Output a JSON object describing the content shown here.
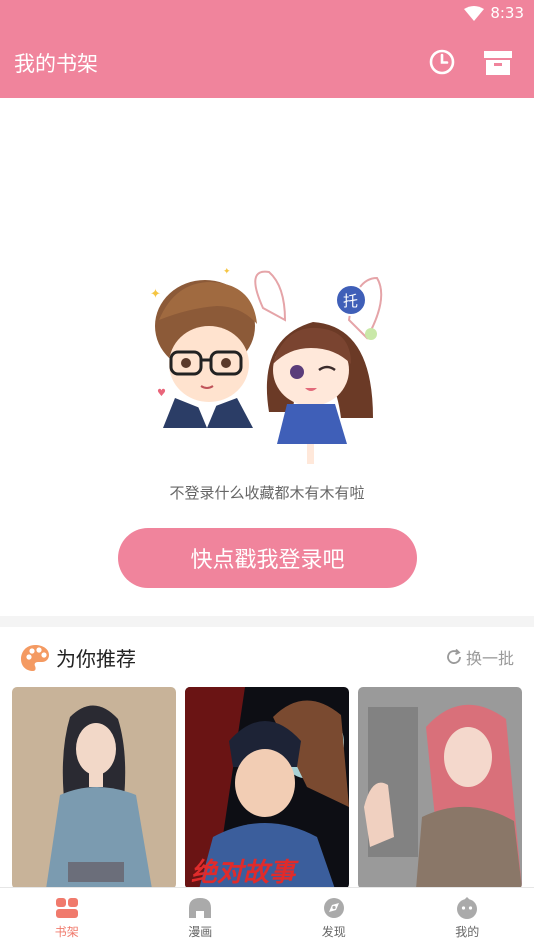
{
  "status": {
    "time": "8:33"
  },
  "header": {
    "title": "我的书架"
  },
  "empty": {
    "message": "不登录什么收藏都木有木有啦",
    "login_label": "快点戳我登录吧"
  },
  "recommend": {
    "title": "为你推荐",
    "refresh_label": "换一批"
  },
  "covers": [
    {
      "title": ""
    },
    {
      "title": "绝对故事"
    },
    {
      "title": ""
    }
  ],
  "tabs": [
    {
      "label": "书架",
      "icon": "bookshelf-icon",
      "active": true
    },
    {
      "label": "漫画",
      "icon": "comic-icon",
      "active": false
    },
    {
      "label": "发现",
      "icon": "discover-icon",
      "active": false
    },
    {
      "label": "我的",
      "icon": "profile-icon",
      "active": false
    }
  ],
  "colors": {
    "brand": "#f0849c",
    "active_tab": "#f07a6c",
    "palette_icon": "#f49a62"
  }
}
